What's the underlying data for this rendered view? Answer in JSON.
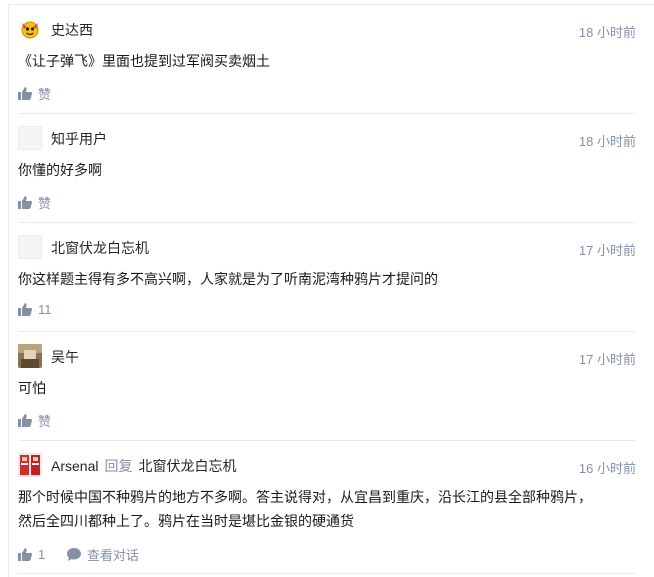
{
  "comments": [
    {
      "author": "史达西",
      "time": "18 小时前",
      "text": "《让子弹飞》里面也提到过军阀买卖烟土",
      "like_label": "赞",
      "avatar_icon": "yellow-cartoon-avatar"
    },
    {
      "author": "知乎用户",
      "time": "18 小时前",
      "text": "你懂的好多啊",
      "like_label": "赞",
      "avatar_icon": "blank-avatar"
    },
    {
      "author": "北窗伏龙白忘机",
      "time": "17 小时前",
      "text": "你这样题主得有多不高兴啊，人家就是为了听南泥湾种鸦片才提问的",
      "like_label": "11",
      "avatar_icon": "blank-avatar"
    },
    {
      "author": "吴午",
      "time": "17 小时前",
      "text": "可怕",
      "like_label": "赞",
      "avatar_icon": "photo-avatar"
    },
    {
      "author": "Arsenal",
      "reply_label": "回复",
      "reply_to": "北窗伏龙白忘机",
      "time": "16 小时前",
      "text_line1": "那个时候中国不种鸦片的地方不多啊。答主说得对，从宜昌到重庆，沿长江的县全部种鸦片，",
      "text_line2": "然后全四川都种上了。鸦片在当时是堪比金银的硬通货",
      "like_label": "1",
      "view_conversation_label": "查看对话",
      "avatar_icon": "red-jersey-avatar"
    }
  ],
  "colors": {
    "meta": "#8590a6",
    "text": "#1a1a1a",
    "divider": "#ebebeb"
  }
}
